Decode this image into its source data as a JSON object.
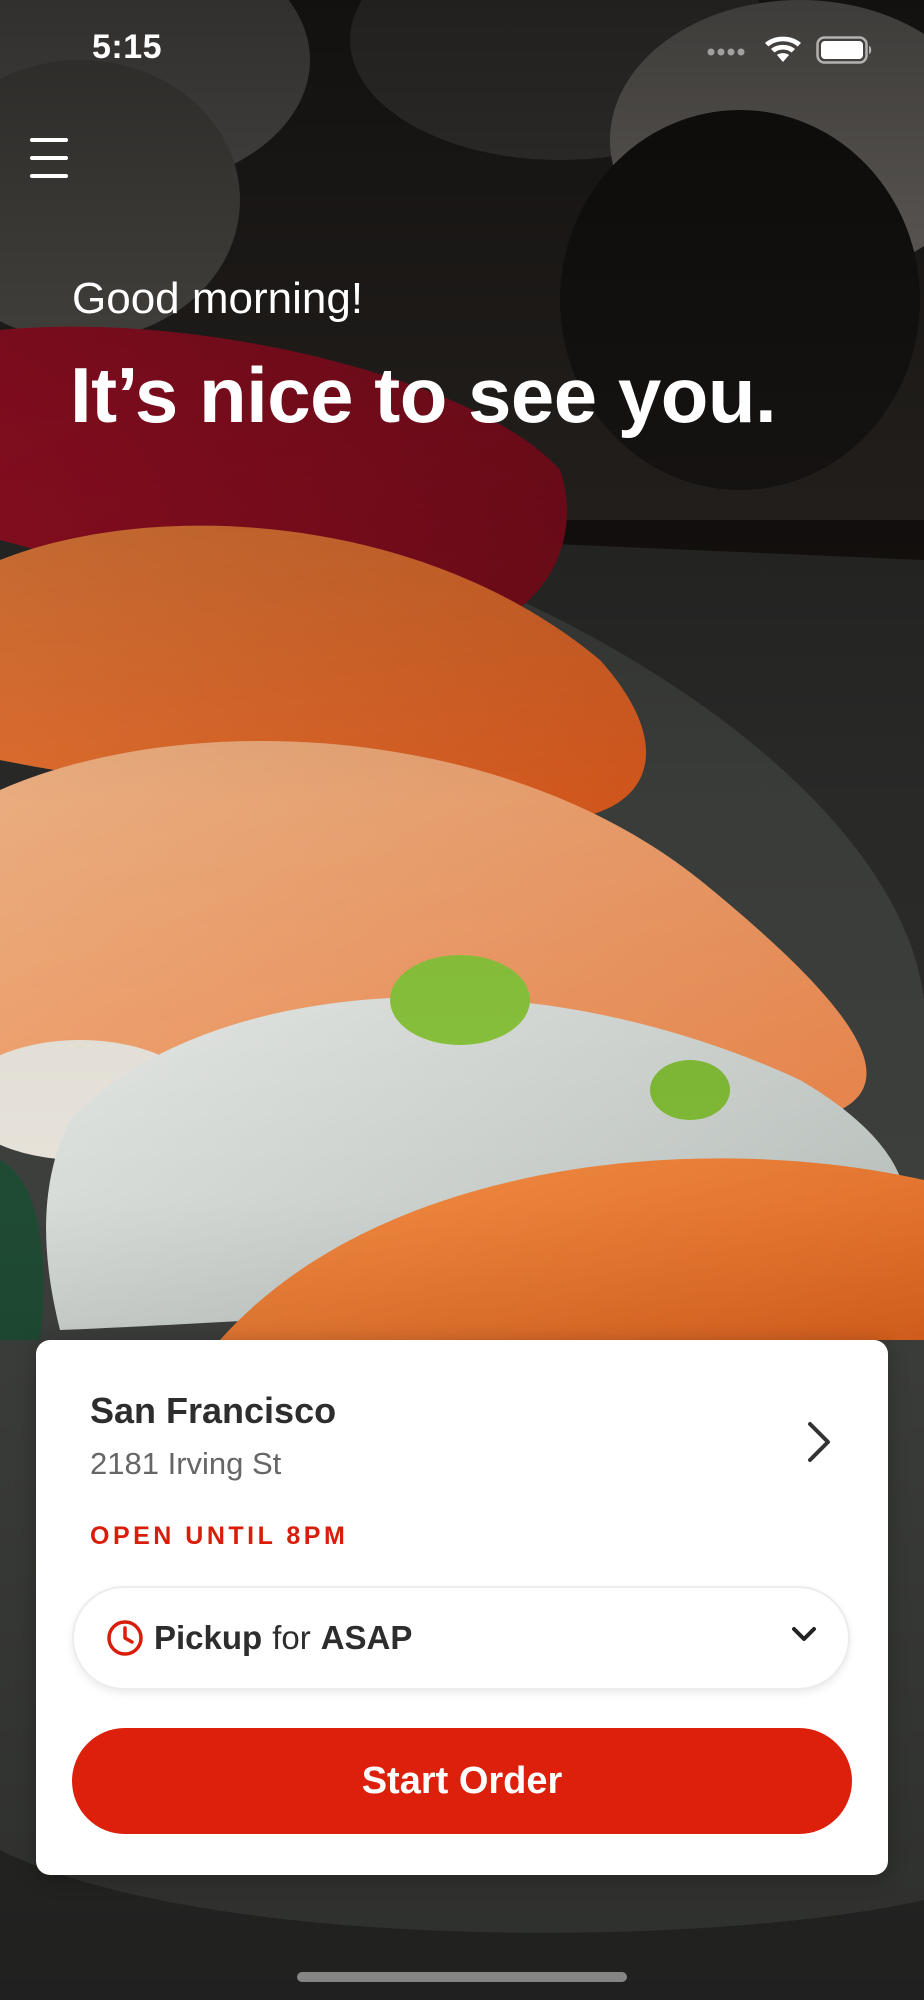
{
  "status_bar": {
    "time": "5:15",
    "icons": [
      "signal-icon",
      "wifi-icon",
      "battery-icon"
    ]
  },
  "header": {
    "menu_icon": "hamburger-menu-icon",
    "greeting": "Good morning!",
    "headline": "It’s nice to see you."
  },
  "location_card": {
    "name": "San Francisco",
    "address": "2181 Irving St",
    "status": "OPEN UNTIL 8PM",
    "pickup": {
      "mode": "Pickup",
      "connector": "for",
      "time": "ASAP"
    },
    "start_order_label": "Start Order"
  },
  "colors": {
    "accent": "#dd200b",
    "status_red": "#d81e0a",
    "card_bg": "#ffffff",
    "text_dark": "#2d2d2d",
    "text_muted": "#666666"
  }
}
